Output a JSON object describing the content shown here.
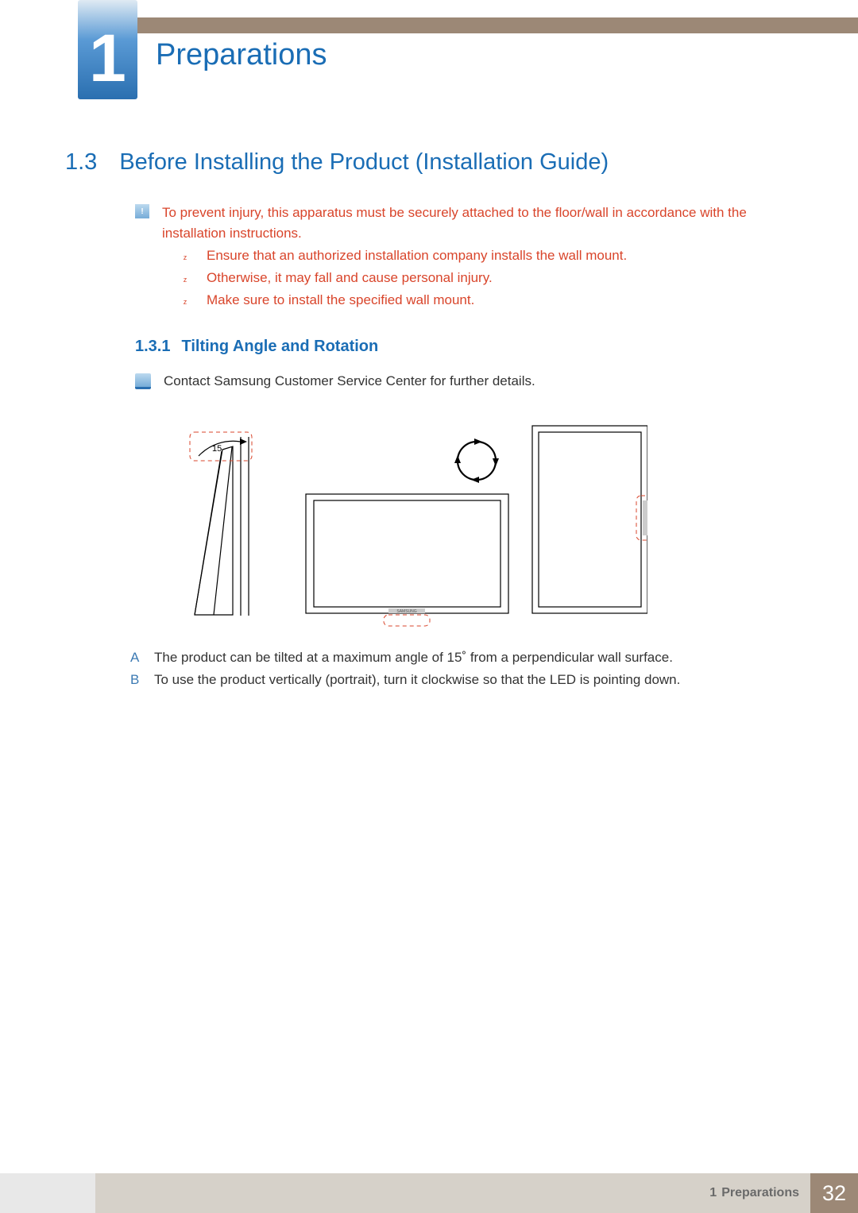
{
  "chapter": {
    "number": "1",
    "title": "Preparations"
  },
  "section": {
    "number": "1.3",
    "title": "Before Installing the Product (Installation Guide)"
  },
  "warning": {
    "text": "To prevent injury, this apparatus must be securely attached to the floor/wall in accordance with the installation instructions.",
    "bullets": [
      "Ensure that an authorized installation company installs the wall mount.",
      "Otherwise, it may fall and cause personal injury.",
      "Make sure to install the specified wall mount."
    ]
  },
  "subsection": {
    "number": "1.3.1",
    "title": "Tilting Angle and Rotation"
  },
  "note": "Contact Samsung Customer Service Center for further details.",
  "diagram": {
    "angle_label": "15",
    "brand_label": "SAMSUNG"
  },
  "items": [
    {
      "letter": "A",
      "text": "The product can be tilted at a maximum angle of 15˚ from a perpendicular wall surface."
    },
    {
      "letter": "B",
      "text": "To use the product vertically (portrait), turn it clockwise so that the LED is pointing down."
    }
  ],
  "footer": {
    "chapter_ref_num": "1",
    "chapter_ref_title": "Preparations",
    "page_number": "32"
  }
}
